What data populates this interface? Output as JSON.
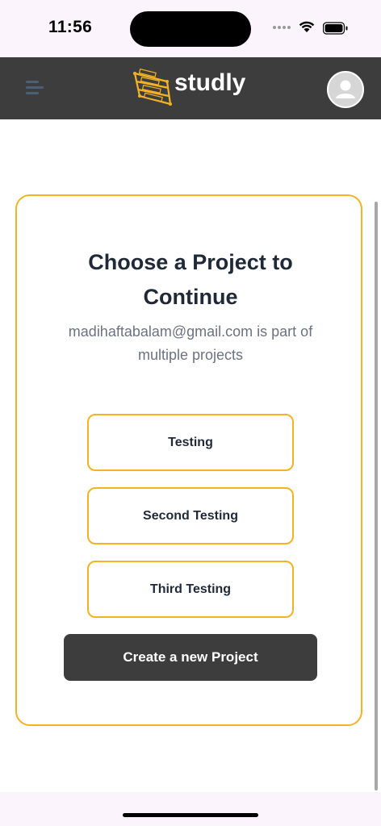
{
  "status_bar": {
    "time": "11:56",
    "icons": [
      "signal-dots-icon",
      "wifi-icon",
      "battery-icon"
    ]
  },
  "header": {
    "app_name": "studly",
    "menu_icon": "hamburger-menu-icon",
    "logo_icon": "studly-logo-icon",
    "avatar_icon": "user-avatar-icon",
    "background": "#3d3d3d"
  },
  "main": {
    "title": "Choose a Project to Continue",
    "subtitle": "madihaftabalam@gmail.com is part of multiple projects",
    "projects": [
      {
        "label": "Testing"
      },
      {
        "label": "Second Testing"
      },
      {
        "label": "Third Testing"
      }
    ],
    "create_button_label": "Create a new Project"
  },
  "colors": {
    "accent": "#f5b324",
    "dark": "#3d3d3d",
    "text_primary": "#1f2937",
    "text_secondary": "#6b7280"
  }
}
